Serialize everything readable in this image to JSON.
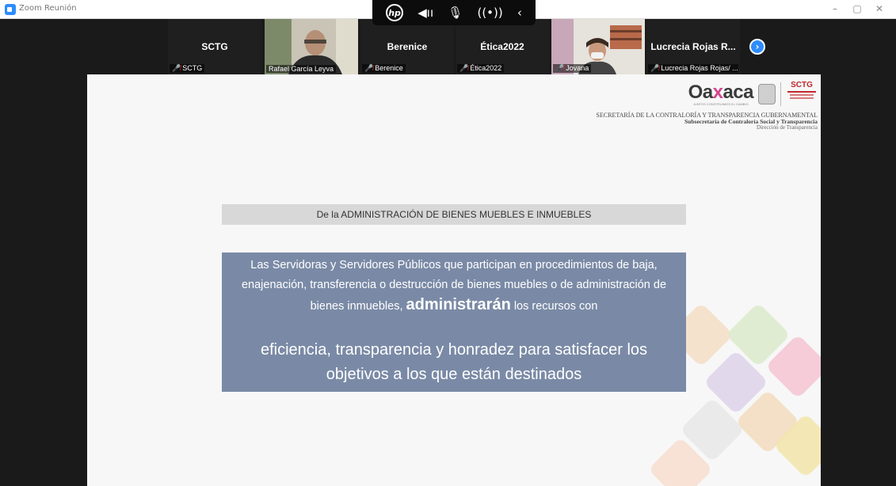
{
  "window": {
    "title": "Zoom Reunión"
  },
  "hp_toolbar": {
    "logo": "hp",
    "icons": [
      "speaker-icon",
      "microphone-icon",
      "broadcast-icon",
      "chevron-left-icon"
    ]
  },
  "participants": [
    {
      "name": "SCTG",
      "label": "SCTG",
      "muted": true,
      "video": false
    },
    {
      "name": "",
      "label": "Rafael García Leyva",
      "muted": false,
      "video": true
    },
    {
      "name": "Berenice",
      "label": "Berenice",
      "muted": true,
      "video": false
    },
    {
      "name": "Ética2022",
      "label": "Ética2022",
      "muted": true,
      "video": false
    },
    {
      "name": "",
      "label": "Jovana",
      "muted": true,
      "video": true
    },
    {
      "name": "Lucrecia Rojas R...",
      "label": "Lucrecia Rojas Rojas/ ...",
      "muted": true,
      "video": false
    }
  ],
  "slide": {
    "logo": {
      "brand_pre": "Oa",
      "brand_x": "x",
      "brand_post": "aca",
      "tagline": "JUNTOS CONSTRUIMOS EL CAMBIO",
      "sctg": "SCTG"
    },
    "header": {
      "line1": "SECRETARÍA DE LA CONTRALORÍA Y TRANSPARENCIA GUBERNAMENTAL",
      "line2": "Subsecretaría de Contraloría Social y Transparencia",
      "line3": "Dirección de Transparencia"
    },
    "section_title": "De la ADMINISTRACIÓN DE BIENES MUEBLES E INMUEBLES",
    "body": {
      "part1": "Las Servidoras y Servidores Públicos que participan en procedimientos de baja, enajenación, transferencia o destrucción de bienes muebles o de administración de bienes inmuebles,",
      "emphasis": "administrarán",
      "part2": "los recursos con",
      "part3": "eficiencia, transparencia y honradez para satisfacer los objetivos a los que están destinados"
    }
  },
  "colors": {
    "zoom_blue": "#2d8cff",
    "muted_red": "#e02828",
    "body_box": "#7a8aa6",
    "section_bar": "#d8d8d8",
    "sctg_red": "#c0282d"
  }
}
